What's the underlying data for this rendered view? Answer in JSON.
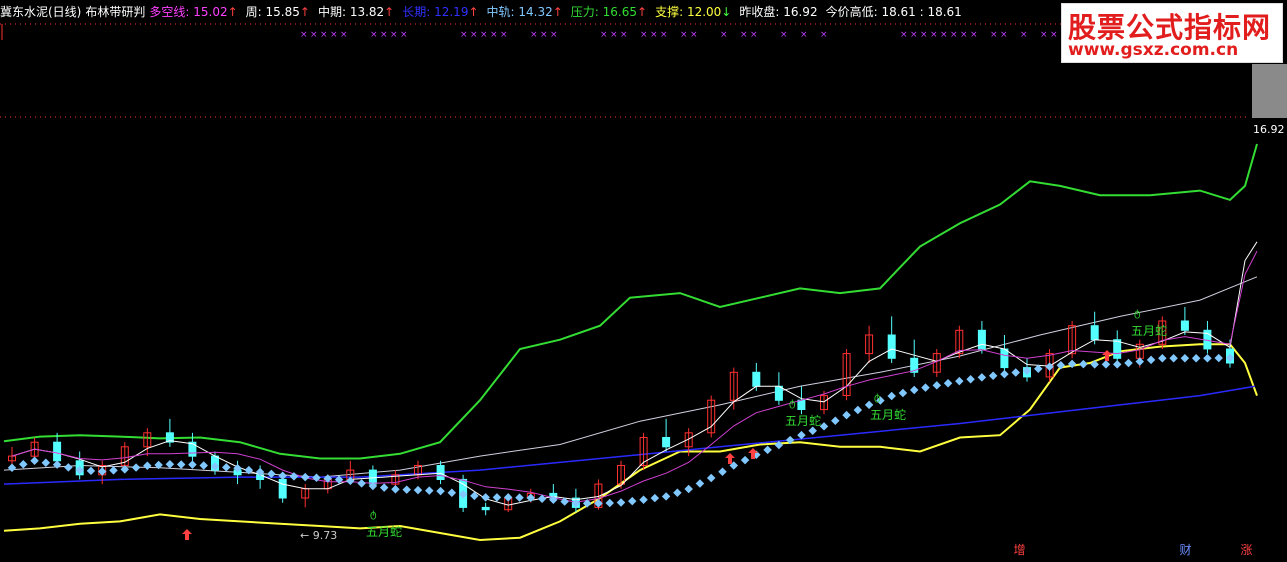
{
  "header": {
    "stock_name": "冀东水泥(日线)",
    "indicator_name": "布林带研判",
    "items": [
      {
        "label": "多空线:",
        "value": "15.02",
        "arrow": "↑",
        "color": "#ff40ff",
        "arrow_color": "#ff4040"
      },
      {
        "label": "周:",
        "value": "15.85",
        "arrow": "↑",
        "color": "#ffffff",
        "arrow_color": "#ff4040"
      },
      {
        "label": "中期:",
        "value": "13.82",
        "arrow": "↑",
        "color": "#ffffff",
        "arrow_color": "#ff4040"
      },
      {
        "label": "长期:",
        "value": "12.19",
        "arrow": "↑",
        "color": "#3030ff",
        "arrow_color": "#ff4040"
      },
      {
        "label": "中轨:",
        "value": "14.32",
        "arrow": "↑",
        "color": "#80c8ff",
        "arrow_color": "#ff4040"
      },
      {
        "label": "压力:",
        "value": "16.65",
        "arrow": "↑",
        "color": "#33dd33",
        "arrow_color": "#ff4040"
      },
      {
        "label": "支撑:",
        "value": "12.00",
        "arrow": "↓",
        "color": "#ffff40",
        "arrow_color": "#40ff40"
      },
      {
        "label": "昨收盘:",
        "value": "16.92",
        "arrow": "",
        "color": "#ffffff",
        "arrow_color": "#ffffff"
      },
      {
        "label": "今价高低:",
        "value": "18.61 : 18.61",
        "arrow": "",
        "color": "#ffffff",
        "arrow_color": "#ffffff"
      }
    ]
  },
  "watermark": {
    "title": "股票公式指标网",
    "url": "www.gsxz.com.cn"
  },
  "price_tag": "16.92",
  "low_label": "9.73",
  "snake_label": "五月蛇",
  "snake_symbol": "ტ",
  "bottom_badges": [
    "增",
    "财",
    "涨"
  ],
  "colors": {
    "up": "#ff3030",
    "down": "#54ffff",
    "upper_band": "#33dd33",
    "lower_band": "#ffff40",
    "mid_band": "#80c8ff",
    "long_line": "#2a2aff",
    "mid_line": "#d0d0e0",
    "short_line": "#ffffff",
    "pink_line": "#d040d0",
    "grid": "#ff3030"
  },
  "chart_data": {
    "type": "candlestick",
    "ylim": [
      9.2,
      18.0
    ],
    "last_price": 16.92,
    "low_marker": 9.73,
    "candles": [
      [
        10.9,
        11.2,
        10.7,
        11.0
      ],
      [
        11.0,
        11.4,
        10.9,
        11.3
      ],
      [
        11.3,
        11.5,
        10.8,
        10.9
      ],
      [
        10.9,
        11.1,
        10.5,
        10.6
      ],
      [
        10.6,
        10.9,
        10.4,
        10.8
      ],
      [
        10.8,
        11.3,
        10.7,
        11.2
      ],
      [
        11.2,
        11.6,
        11.0,
        11.5
      ],
      [
        11.5,
        11.8,
        11.2,
        11.3
      ],
      [
        11.3,
        11.5,
        10.9,
        11.0
      ],
      [
        11.0,
        11.1,
        10.6,
        10.7
      ],
      [
        10.7,
        10.9,
        10.4,
        10.6
      ],
      [
        10.6,
        10.8,
        10.3,
        10.5
      ],
      [
        10.5,
        10.6,
        10.0,
        10.1
      ],
      [
        10.1,
        10.4,
        9.9,
        10.3
      ],
      [
        10.3,
        10.6,
        10.2,
        10.5
      ],
      [
        10.5,
        10.9,
        10.4,
        10.7
      ],
      [
        10.7,
        10.8,
        10.3,
        10.4
      ],
      [
        10.4,
        10.7,
        10.2,
        10.6
      ],
      [
        10.6,
        10.9,
        10.5,
        10.8
      ],
      [
        10.8,
        10.9,
        10.4,
        10.5
      ],
      [
        10.5,
        10.6,
        9.8,
        9.9
      ],
      [
        9.9,
        10.0,
        9.73,
        9.85
      ],
      [
        9.85,
        10.2,
        9.8,
        10.1
      ],
      [
        10.1,
        10.3,
        10.0,
        10.2
      ],
      [
        10.2,
        10.4,
        10.0,
        10.1
      ],
      [
        10.1,
        10.3,
        9.8,
        9.9
      ],
      [
        9.9,
        10.5,
        9.85,
        10.4
      ],
      [
        10.4,
        10.9,
        10.3,
        10.8
      ],
      [
        10.8,
        11.5,
        10.7,
        11.4
      ],
      [
        11.4,
        11.8,
        11.1,
        11.2
      ],
      [
        11.2,
        11.6,
        11.0,
        11.5
      ],
      [
        11.5,
        12.3,
        11.4,
        12.2
      ],
      [
        12.2,
        12.9,
        12.0,
        12.8
      ],
      [
        12.8,
        13.0,
        12.4,
        12.5
      ],
      [
        12.5,
        12.8,
        12.1,
        12.2
      ],
      [
        12.2,
        12.5,
        11.9,
        12.0
      ],
      [
        12.0,
        12.4,
        11.9,
        12.3
      ],
      [
        12.3,
        13.3,
        12.2,
        13.2
      ],
      [
        13.2,
        13.8,
        13.0,
        13.6
      ],
      [
        13.6,
        14.0,
        13.0,
        13.1
      ],
      [
        13.1,
        13.5,
        12.7,
        12.8
      ],
      [
        12.8,
        13.3,
        12.7,
        13.2
      ],
      [
        13.2,
        13.8,
        13.1,
        13.7
      ],
      [
        13.7,
        13.9,
        13.2,
        13.3
      ],
      [
        13.3,
        13.6,
        12.8,
        12.9
      ],
      [
        12.9,
        13.1,
        12.6,
        12.7
      ],
      [
        12.7,
        13.3,
        12.6,
        13.2
      ],
      [
        13.2,
        13.9,
        13.1,
        13.8
      ],
      [
        13.8,
        14.1,
        13.4,
        13.5
      ],
      [
        13.5,
        13.7,
        13.0,
        13.1
      ],
      [
        13.1,
        13.5,
        12.9,
        13.4
      ],
      [
        13.4,
        14.0,
        13.3,
        13.9
      ],
      [
        13.9,
        14.2,
        13.6,
        13.7
      ],
      [
        13.7,
        13.9,
        13.2,
        13.3
      ],
      [
        13.3,
        13.5,
        12.9,
        13.0
      ]
    ]
  }
}
